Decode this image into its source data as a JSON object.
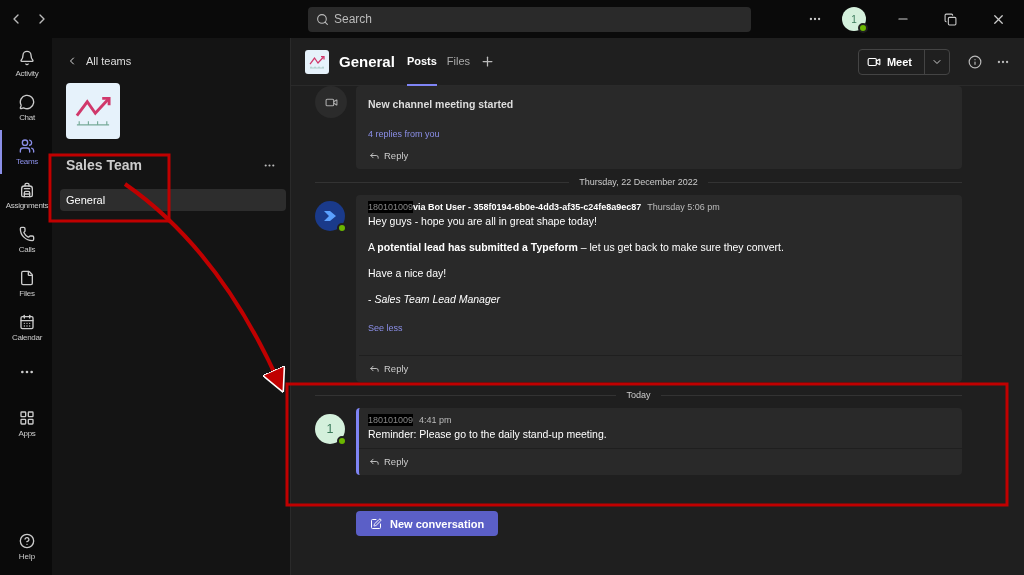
{
  "titlebar": {
    "search": {
      "placeholder": "Search"
    },
    "avatar": "1",
    "avatar_online": true
  },
  "rail": [
    {
      "label": "Activity",
      "selected": false
    },
    {
      "label": "Chat",
      "selected": false
    },
    {
      "label": "Teams",
      "selected": true
    },
    {
      "label": "Assignments",
      "selected": false
    },
    {
      "label": "Calls",
      "selected": false
    },
    {
      "label": "Files",
      "selected": false
    },
    {
      "label": "Calendar",
      "selected": false
    },
    {
      "selected": false
    },
    {
      "label": "Apps",
      "selected": false
    }
  ],
  "help": "Help",
  "team_panel": {
    "back": "All teams",
    "team_name": "Sales Team",
    "channels": [
      {
        "name": "General",
        "selected": true
      }
    ]
  },
  "channel": {
    "name": "General",
    "tabs": [
      {
        "label": "Posts",
        "selected": true
      },
      {
        "label": "Files",
        "selected": false
      }
    ],
    "meet": "Meet"
  },
  "feed": [
    {
      "kind": "meeting",
      "title": "New channel meeting started",
      "replies": "4 replies from you",
      "reply": "Reply"
    },
    {
      "kind": "divider",
      "label": "Thursday, 22 December 2022"
    },
    {
      "kind": "message",
      "online": true,
      "highlight": false,
      "author": "180101009",
      "via": "via Bot User - 358f0194-6b0e-4dd3-af35-c24fe8a9ec87",
      "time": "Thursday 5:06 pm",
      "lines": [
        "Hey guys - hope you are all in great shape today!",
        "A **potential lead has submitted a Typeform** – let us get back to make sure they convert.",
        "Have a nice day!",
        "- *Sales Team Lead Manager*"
      ],
      "link": "See less",
      "reply": "Reply"
    },
    {
      "kind": "divider",
      "label": "Today"
    },
    {
      "kind": "message",
      "avatar": "1",
      "online": true,
      "highlight": true,
      "author": "180101009",
      "time": "4:41 pm",
      "lines": [
        "Reminder: Please go to the daily stand-up meeting."
      ],
      "reply": "Reply"
    }
  ],
  "new_conversation": "New conversation"
}
